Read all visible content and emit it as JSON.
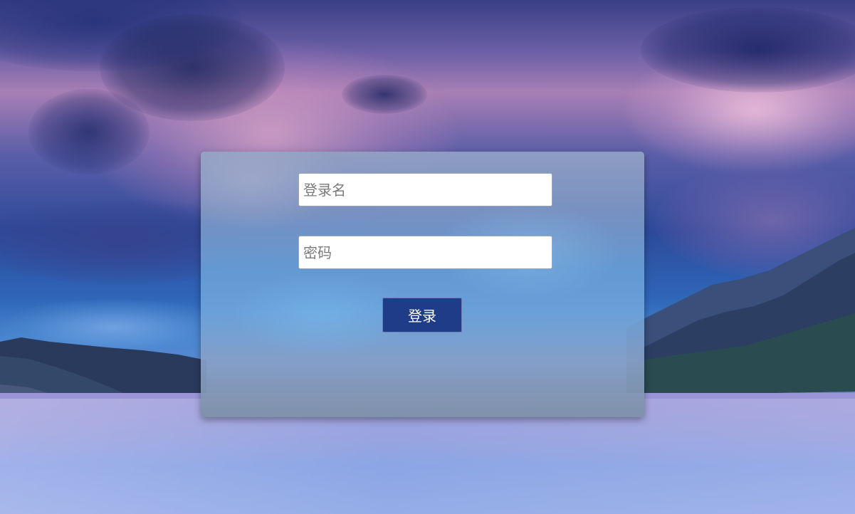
{
  "login_form": {
    "username_placeholder": "登录名",
    "username_value": "",
    "password_placeholder": "密码",
    "password_value": "",
    "submit_label": "登录"
  },
  "colors": {
    "button_background": "#1f3c88",
    "button_text": "#ffffff",
    "input_background": "#ffffff",
    "placeholder_text": "#7a7a7a"
  }
}
